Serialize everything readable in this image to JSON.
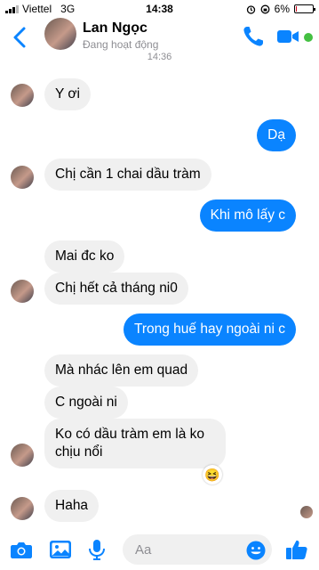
{
  "status_bar": {
    "carrier": "Viettel",
    "network": "3G",
    "time": "14:38",
    "battery": "6%",
    "battery_level": 0.06
  },
  "header": {
    "name": "Lan Ngọc",
    "status": "Đang hoạt động"
  },
  "timestamp": "14:36",
  "messages": [
    {
      "from": "them",
      "text": "Y ơi"
    },
    {
      "from": "me",
      "text": "Dạ"
    },
    {
      "from": "them",
      "text": "Chị cần 1 chai dầu tràm"
    },
    {
      "from": "me",
      "text": "Khi mô lấy c"
    },
    {
      "from": "them",
      "text": "Mai đc ko"
    },
    {
      "from": "them",
      "text": "Chị hết cả tháng ni0"
    },
    {
      "from": "me",
      "text": "Trong huế hay ngoài ni c"
    },
    {
      "from": "them",
      "text": "Mà nhác lên em quad"
    },
    {
      "from": "them",
      "text": "C ngoài ni"
    },
    {
      "from": "them",
      "text": "Ko có dầu tràm em là ko chịu nổi"
    },
    {
      "from": "them",
      "text": "Haha"
    }
  ],
  "reaction_emoji": "😆",
  "composer": {
    "placeholder": "Aa"
  },
  "colors": {
    "accent": "#0a84ff",
    "incoming_bubble": "#f0f0f0",
    "online": "#44c042"
  }
}
